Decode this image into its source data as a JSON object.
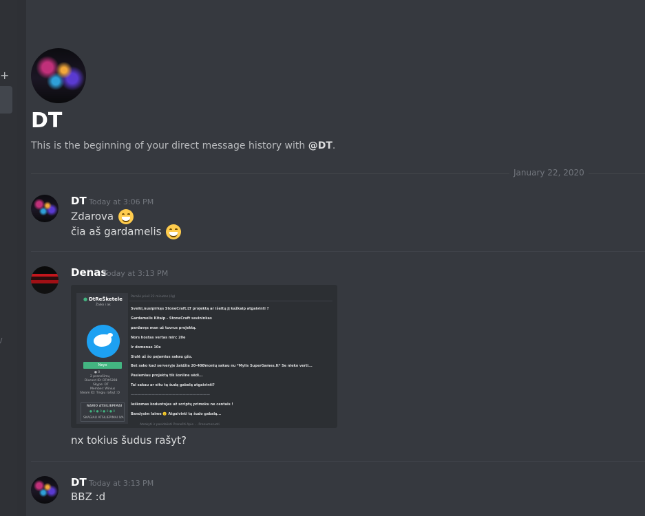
{
  "sidebar": {
    "add_symbol": "+",
    "mark_symbol": "/"
  },
  "header": {
    "title": "DT",
    "subtitle_prefix": "This is the beginning of your direct message history with ",
    "subtitle_mention": "@DT",
    "subtitle_suffix": "."
  },
  "divider": {
    "date": "January 22, 2020"
  },
  "messages": [
    {
      "author": "DT",
      "timestamp": "Today at 3:06 PM",
      "lines": [
        "Zdarova",
        "čia aš gardamelis"
      ],
      "emoji": "grinning-face-with-smiling-eyes"
    },
    {
      "author": "Denas",
      "timestamp": "Today at 3:13 PM",
      "text": "nx tokius šudus rašyt?",
      "attachment": {
        "profile_name": "DtReŠketele",
        "status": "Žaiko i ak",
        "button": "Neyo",
        "stats": [
          "● 0",
          "2 pranešimų",
          "Discord ID: DT#6398",
          "Skype: DT",
          "Member: Winius",
          "Steam ID: Tingiu rašiyt :D"
        ],
        "box_title": "NARIO ATSILIEPIMAI",
        "box_counts": "● 0 ● 0 ● 0 ● 0",
        "box_footer": "SKAGIAU ATSILIEPIMAI IVA",
        "header_text": "Parašė prieš 22 minutes (šg)",
        "lines": [
          "Sveiki,nusipirkęs StoneCraft.LT projektą ar išeitų jį kažkaip atgaivinti ?",
          "Gardamelis Kitaip - StoneCraft savininkas",
          "pardavęs man už tuvrus projektą.",
          "Nors hostas vertas min: 20e",
          "Ir domenas 10e",
          "Siulė už šo pajamius sakau gžo.",
          "Bet sako kad serveryje žaidžia 20-40Ømonių sakau nu *Mylis SuperGames.lt* Se nieko verti...",
          "Pasiemiau projektą tik šonline sėdi...",
          "Tai sakau ar eitu tą šudą gabelą atgaivinti?",
          "———————————————————————",
          "Ieškomas koduotojas už scriptų primoku ne centais !",
          "Bandysim laime 🙂 Atgaivinti tą šudo gabalą..."
        ],
        "footer_text": "Atsakyti ir pasidalinti   Pranešti Apie ...   Prenumeruoti"
      }
    },
    {
      "author": "DT",
      "timestamp": "Today at 3:13 PM",
      "text": "BBZ :d"
    }
  ]
}
